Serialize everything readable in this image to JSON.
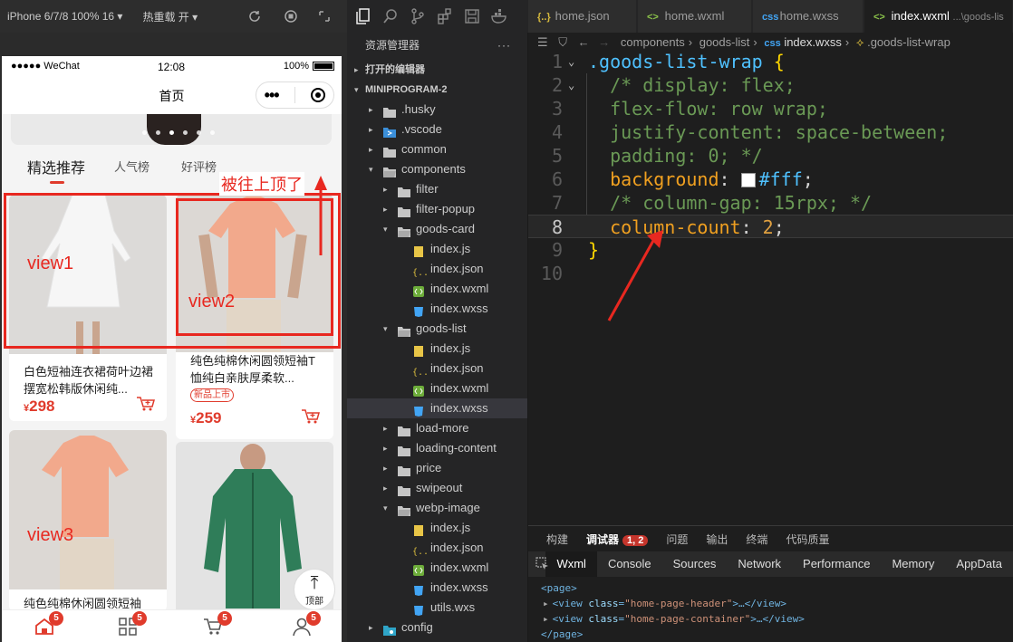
{
  "simulator": {
    "device_label": "iPhone 6/7/8 100% 16 ▾",
    "hotreload_label": "热重载 开 ▾",
    "status": {
      "carrier": "●●●●● WeChat",
      "time": "12:08",
      "battery": "100%"
    },
    "nav_title": "首页",
    "tabs": [
      "精选推荐",
      "人气榜",
      "好评榜"
    ],
    "annotation_top": "被往上顶了",
    "view_labels": [
      "view1",
      "view2",
      "view3"
    ],
    "cards": [
      {
        "name": "白色短袖连衣裙荷叶边裙摆宽松韩版休闲纯...",
        "price_symbol": "¥",
        "price": "298"
      },
      {
        "name": "纯色纯棉休闲圆领短袖T恤纯白亲肤厚柔软...",
        "badge": "新品上市",
        "price_symbol": "¥",
        "price": "259"
      },
      {
        "name": "纯色纯棉休闲圆领短袖"
      }
    ],
    "back_to_top": "顶部",
    "tabbar": [
      {
        "badge": "5"
      },
      {
        "badge": "5"
      },
      {
        "badge": "5"
      },
      {
        "badge": "5"
      }
    ]
  },
  "explorer": {
    "title": "资源管理器",
    "more": "···",
    "open_editors": "打开的编辑器",
    "project": "MINIPROGRAM-2",
    "tree": [
      {
        "label": ".husky",
        "kind": "folder"
      },
      {
        "label": ".vscode",
        "kind": "vscode"
      },
      {
        "label": "common",
        "kind": "folder"
      },
      {
        "label": "components",
        "kind": "folder-open"
      },
      {
        "label": "filter",
        "kind": "folder"
      },
      {
        "label": "filter-popup",
        "kind": "folder"
      },
      {
        "label": "goods-card",
        "kind": "folder-open"
      },
      {
        "label": "index.js",
        "kind": "js"
      },
      {
        "label": "index.json",
        "kind": "json"
      },
      {
        "label": "index.wxml",
        "kind": "wxml"
      },
      {
        "label": "index.wxss",
        "kind": "wxss"
      },
      {
        "label": "goods-list",
        "kind": "folder-open"
      },
      {
        "label": "index.js",
        "kind": "js"
      },
      {
        "label": "index.json",
        "kind": "json"
      },
      {
        "label": "index.wxml",
        "kind": "wxml"
      },
      {
        "label": "index.wxss",
        "kind": "wxss"
      },
      {
        "label": "load-more",
        "kind": "folder"
      },
      {
        "label": "loading-content",
        "kind": "folder"
      },
      {
        "label": "price",
        "kind": "folder"
      },
      {
        "label": "swipeout",
        "kind": "folder"
      },
      {
        "label": "webp-image",
        "kind": "folder-open"
      },
      {
        "label": "index.js",
        "kind": "js"
      },
      {
        "label": "index.json",
        "kind": "json"
      },
      {
        "label": "index.wxml",
        "kind": "wxml"
      },
      {
        "label": "index.wxss",
        "kind": "wxss"
      },
      {
        "label": "utils.wxs",
        "kind": "wxs"
      },
      {
        "label": "config",
        "kind": "config"
      }
    ]
  },
  "editor": {
    "tabs": [
      {
        "label": "home.json",
        "icon": "{..}"
      },
      {
        "label": "home.wxml",
        "icon": "<>"
      },
      {
        "label": "home.wxss",
        "icon": "css"
      },
      {
        "label": "index.wxml",
        "icon": "<>",
        "path": "...\\goods-lis"
      }
    ],
    "breadcrumbs": [
      "components",
      "goods-list",
      "index.wxss",
      ".goods-list-wrap"
    ],
    "lines": [
      {
        "n": "1",
        "selector": ".goods-list-wrap",
        "brace": "{"
      },
      {
        "n": "2",
        "comment": "/* display: flex;"
      },
      {
        "n": "3",
        "comment": "flex-flow: row wrap;"
      },
      {
        "n": "4",
        "comment": "justify-content: space-between;"
      },
      {
        "n": "5",
        "comment": "padding: 0; */"
      },
      {
        "n": "6",
        "prop": "background",
        "value": "#fff"
      },
      {
        "n": "7",
        "comment": "/* column-gap: 15rpx; */"
      },
      {
        "n": "8",
        "prop": "column-count",
        "value": "2"
      },
      {
        "n": "9",
        "brace": "}"
      },
      {
        "n": "10"
      }
    ]
  },
  "debug": {
    "tabs": [
      "构建",
      "调试器",
      "问题",
      "输出",
      "终端",
      "代码质量"
    ],
    "debugger_count": "1, 2",
    "devtools_tabs": [
      "Wxml",
      "Console",
      "Sources",
      "Network",
      "Performance",
      "Memory",
      "AppData"
    ],
    "wxml": {
      "page_open": "<page>",
      "rows": [
        {
          "tag": "view",
          "attr": "class",
          "value": "home-page-header",
          "tail": ">…</view>"
        },
        {
          "tag": "view",
          "attr": "class",
          "value": "home-page-container",
          "tail": ">…</view>"
        }
      ],
      "page_close": "</page>"
    }
  },
  "colors": {
    "accent_red": "#e03b2c",
    "annotation_red": "#e82820",
    "editor_bg": "#1e1e1e"
  }
}
